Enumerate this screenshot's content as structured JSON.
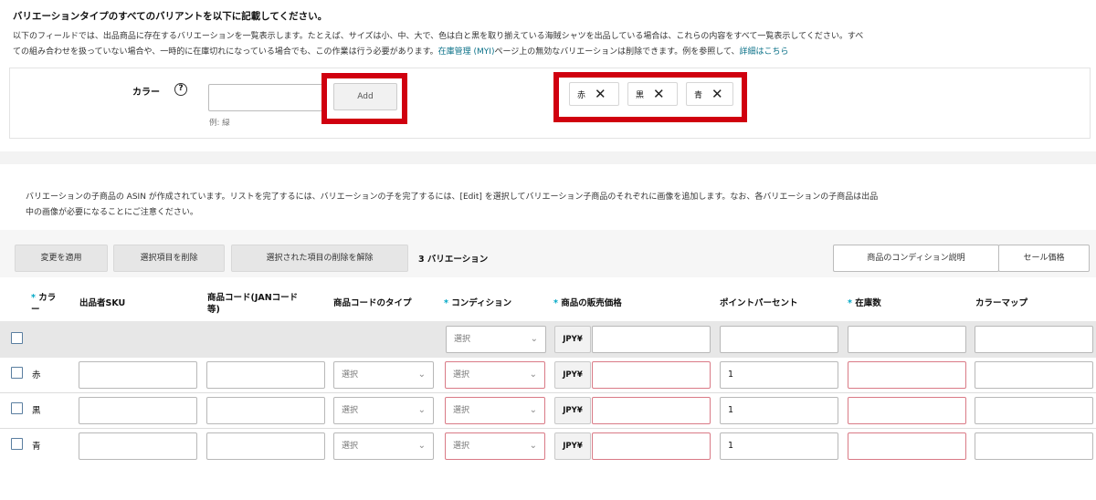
{
  "top": {
    "heading": "バリエーションタイプのすべてのバリアントを以下に記載してください。",
    "desc_line1": "以下のフィールドでは、出品商品に存在するバリエーションを一覧表示します。たとえば、サイズは小、中、大で、色は白と黒を取り揃えている海賊シャツを出品している場合は、これらの内容をすべて一覧表示してください。すべ",
    "desc_line2_pre": "ての組み合わせを扱っていない場合や、一時的に在庫切れになっている場合でも、この作業は行う必要があります。",
    "desc_link1": "在庫管理 (MYI)",
    "desc_line2_mid": "ページ上の無効なバリエーションは削除できます。例を参照して、",
    "desc_link2": "詳細はこちら"
  },
  "color_field": {
    "label": "カラー",
    "help": "?",
    "value": "",
    "example": "例: 緑",
    "add_label": "Add",
    "chips": [
      "赤",
      "黒",
      "青"
    ],
    "chip_close": "✕"
  },
  "info": {
    "line1": "バリエーションの子商品の ASIN が作成されています。リストを完了するには、バリエーションの子を完了するには、[Edit] を選択してバリエーション子商品のそれぞれに画像を追加します。なお、各バリエーションの子商品は出品",
    "line2": "中の画像が必要になることにご注意ください。"
  },
  "toolbar": {
    "apply": "変更を適用",
    "delete_selected": "選択項目を削除",
    "undo_delete": "選択された項目の削除を解除",
    "count": "3 バリエーション",
    "condition_desc": "商品のコンディション説明",
    "sale_price": "セール価格"
  },
  "table": {
    "required_mark": "*",
    "headers": {
      "color_a": "カラ",
      "color_b": "ー",
      "sku": "出品者SKU",
      "code_a": "商品コード(JANコード",
      "code_b": "等)",
      "code_type": "商品コードのタイプ",
      "condition": "コンディション",
      "price": "商品の販売価格",
      "points": "ポイントパーセント",
      "stock": "在庫数",
      "colormap": "カラーマップ"
    },
    "select_placeholder": "選択",
    "chevron": "⌄",
    "currency": "JPY¥",
    "rows": [
      {
        "color": "赤",
        "points": "1"
      },
      {
        "color": "黒",
        "points": "1"
      },
      {
        "color": "青",
        "points": "1"
      }
    ]
  },
  "colors": {
    "highlight": "#d0000f",
    "link": "#0b7188",
    "required": "#00a8c6",
    "error_border": "#d97a86"
  }
}
